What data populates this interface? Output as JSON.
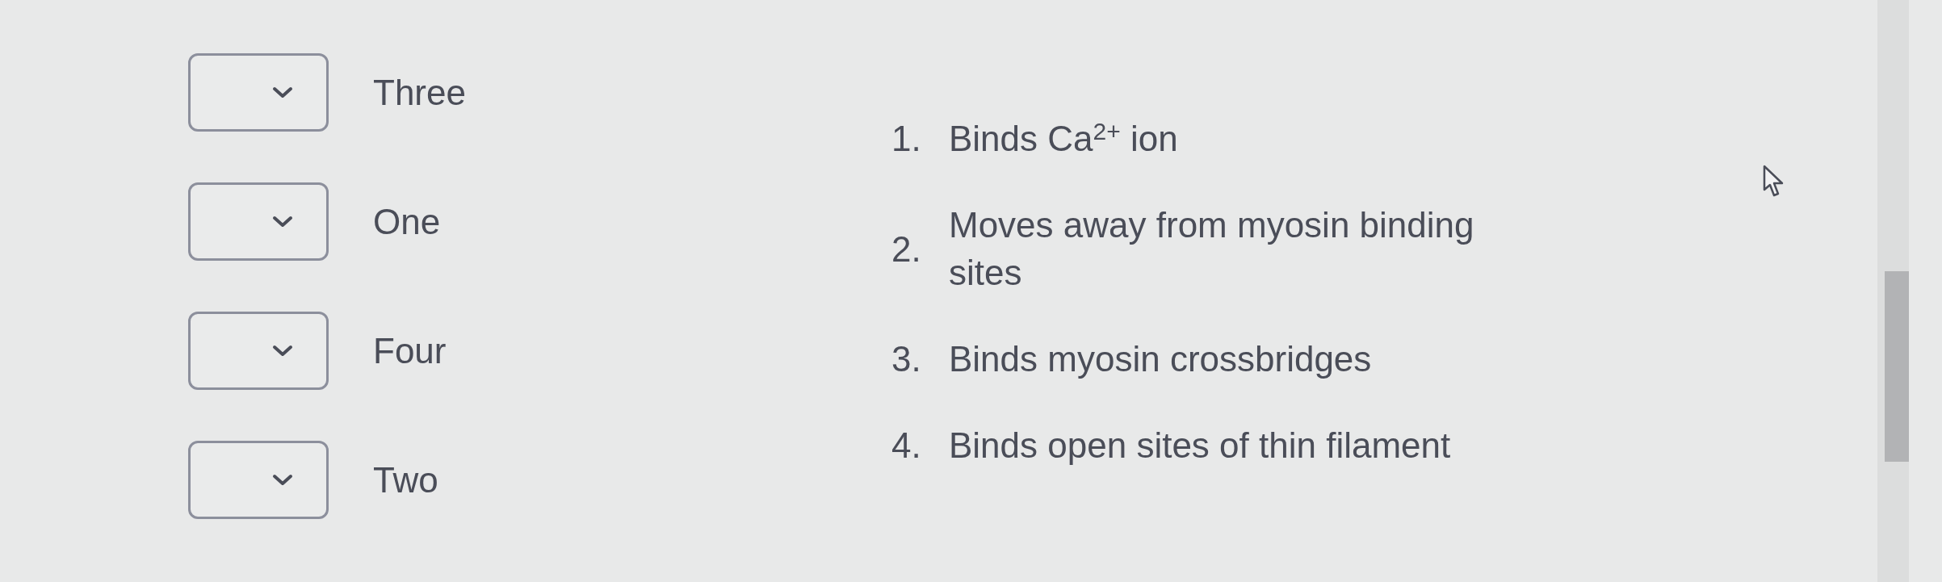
{
  "prompts": [
    {
      "label": "Three"
    },
    {
      "label": "One"
    },
    {
      "label": "Four"
    },
    {
      "label": "Two"
    }
  ],
  "options": [
    {
      "number": "1.",
      "text": "Binds Ca$^{2+}$ ion"
    },
    {
      "number": "2.",
      "text": "Moves away from myosin binding sites"
    },
    {
      "number": "3.",
      "text": "Binds myosin crossbridges"
    },
    {
      "number": "4.",
      "text": "Binds open sites of thin filament"
    }
  ]
}
